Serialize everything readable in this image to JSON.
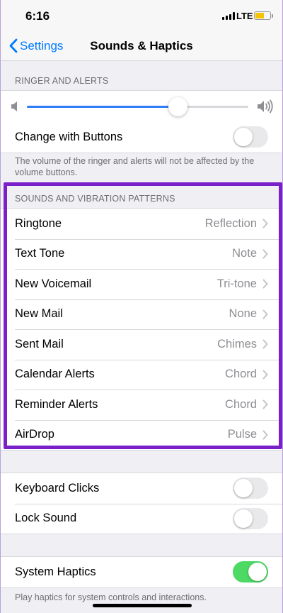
{
  "status_bar": {
    "time": "6:16",
    "network": "LTE"
  },
  "nav": {
    "back_label": "Settings",
    "title": "Sounds & Haptics"
  },
  "ringer": {
    "header": "RINGER AND ALERTS",
    "volume_fraction": 0.68,
    "change_with_buttons_label": "Change with Buttons",
    "change_with_buttons_on": false,
    "footer": "The volume of the ringer and alerts will not be affected by the volume buttons."
  },
  "patterns": {
    "header": "SOUNDS AND VIBRATION PATTERNS",
    "items": [
      {
        "label": "Ringtone",
        "value": "Reflection"
      },
      {
        "label": "Text Tone",
        "value": "Note"
      },
      {
        "label": "New Voicemail",
        "value": "Tri-tone"
      },
      {
        "label": "New Mail",
        "value": "None"
      },
      {
        "label": "Sent Mail",
        "value": "Chimes"
      },
      {
        "label": "Calendar Alerts",
        "value": "Chord"
      },
      {
        "label": "Reminder Alerts",
        "value": "Chord"
      },
      {
        "label": "AirDrop",
        "value": "Pulse"
      }
    ]
  },
  "sounds": {
    "keyboard_clicks_label": "Keyboard Clicks",
    "keyboard_clicks_on": false,
    "lock_sound_label": "Lock Sound",
    "lock_sound_on": false
  },
  "haptics": {
    "system_haptics_label": "System Haptics",
    "system_haptics_on": true,
    "footer": "Play haptics for system controls and interactions."
  },
  "colors": {
    "accent": "#007aff",
    "slider_fill": "#2f7df6",
    "toggle_on": "#4cd964",
    "highlight_border": "#7a20c8",
    "battery": "#f5c400"
  },
  "icons": {
    "back": "chevron-left-icon",
    "row_disclosure": "chevron-right-icon",
    "volume_low": "speaker-low-icon",
    "volume_high": "speaker-high-icon"
  }
}
